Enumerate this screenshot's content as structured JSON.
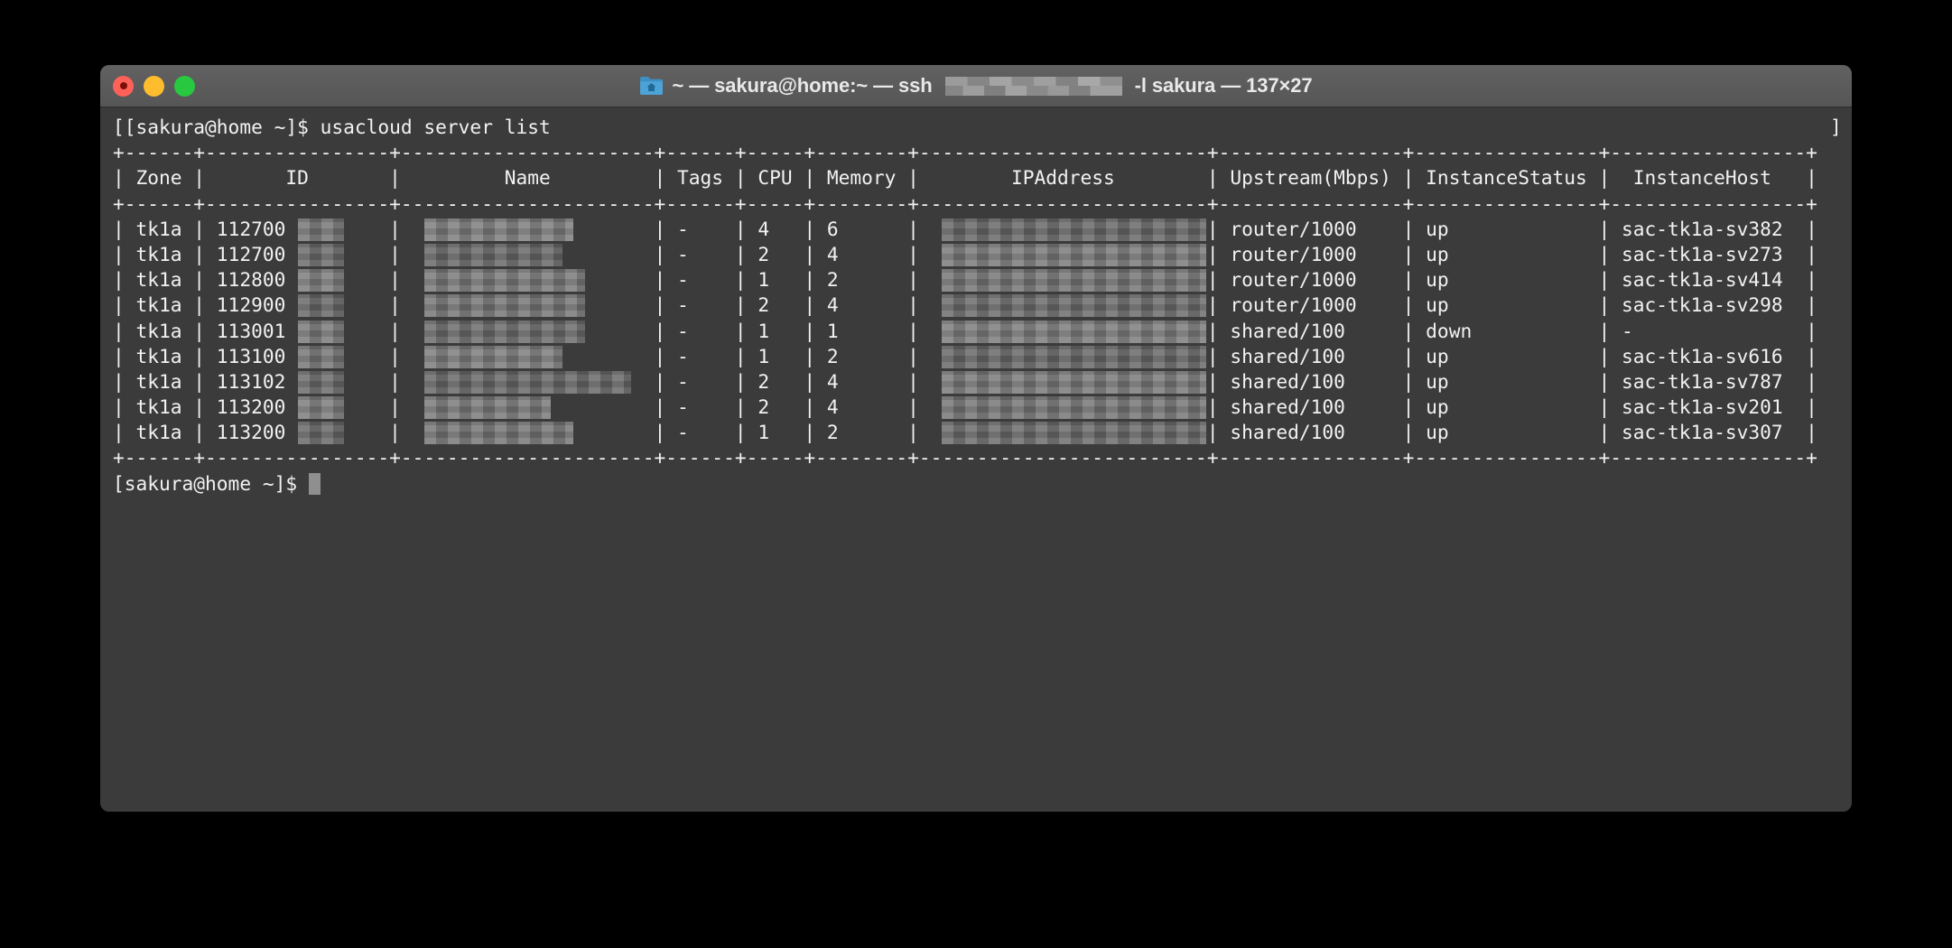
{
  "window": {
    "title_prefix": "~ — sakura@home:~ — ssh ",
    "title_suffix": " -l sakura — 137×27",
    "folder_icon": "home-folder-icon",
    "traffic_lights": [
      {
        "name": "close-button",
        "label": "Close",
        "color": "#ff6159"
      },
      {
        "name": "minimize-button",
        "label": "Minimize",
        "color": "#ffbd2e"
      },
      {
        "name": "maximize-button",
        "label": "Maximize",
        "color": "#28c840"
      }
    ],
    "redacted_host": "[redacted]",
    "columns": "137",
    "rows": "27",
    "titlebar_color": "#5a5a5a",
    "body_color": "#3b3b3b",
    "text_color": "#f2f2f2"
  },
  "terminal": {
    "left_edge_artifact": "[",
    "right_edge_artifact": "]",
    "prompt": "[sakura@home ~]$ ",
    "command": "usacloud server list",
    "final_prompt": "[sakura@home ~]$ ",
    "cursor": "block-cursor"
  },
  "table": {
    "headers": [
      "Zone",
      "ID",
      "Name",
      "Tags",
      "CPU",
      "Memory",
      "IPAddress",
      "Upstream(Mbps)",
      "InstanceStatus",
      "InstanceHost"
    ],
    "separator_char": "+",
    "rule_char": "-",
    "pipe_char": "|",
    "rows": [
      {
        "zone": "tk1a",
        "id": "112700",
        "id_redacted": true,
        "name": "",
        "name_redacted": true,
        "tags": "-",
        "cpu": "4",
        "memory": "6",
        "ip": "",
        "ip_redacted": true,
        "upstream": "router/1000",
        "status": "up",
        "host": "sac-tk1a-sv382"
      },
      {
        "zone": "tk1a",
        "id": "112700",
        "id_redacted": true,
        "name": "",
        "name_redacted": true,
        "tags": "-",
        "cpu": "2",
        "memory": "4",
        "ip": "",
        "ip_redacted": true,
        "upstream": "router/1000",
        "status": "up",
        "host": "sac-tk1a-sv273"
      },
      {
        "zone": "tk1a",
        "id": "112800",
        "id_redacted": true,
        "name": "",
        "name_redacted": true,
        "tags": "-",
        "cpu": "1",
        "memory": "2",
        "ip": "",
        "ip_redacted": true,
        "upstream": "router/1000",
        "status": "up",
        "host": "sac-tk1a-sv414"
      },
      {
        "zone": "tk1a",
        "id": "112900",
        "id_redacted": true,
        "name": "",
        "name_redacted": true,
        "tags": "-",
        "cpu": "2",
        "memory": "4",
        "ip": "",
        "ip_redacted": true,
        "upstream": "router/1000",
        "status": "up",
        "host": "sac-tk1a-sv298"
      },
      {
        "zone": "tk1a",
        "id": "113001",
        "id_redacted": true,
        "name": "",
        "name_redacted": true,
        "tags": "-",
        "cpu": "1",
        "memory": "1",
        "ip": "",
        "ip_redacted": true,
        "upstream": "shared/100",
        "status": "down",
        "host": "-"
      },
      {
        "zone": "tk1a",
        "id": "113100",
        "id_redacted": true,
        "name": "",
        "name_redacted": true,
        "tags": "-",
        "cpu": "1",
        "memory": "2",
        "ip": "",
        "ip_redacted": true,
        "upstream": "shared/100",
        "status": "up",
        "host": "sac-tk1a-sv616"
      },
      {
        "zone": "tk1a",
        "id": "113102",
        "id_redacted": true,
        "name": "",
        "name_redacted": true,
        "tags": "-",
        "cpu": "2",
        "memory": "4",
        "ip": "",
        "ip_redacted": true,
        "upstream": "shared/100",
        "status": "up",
        "host": "sac-tk1a-sv787"
      },
      {
        "zone": "tk1a",
        "id": "113200",
        "id_redacted": true,
        "name": "",
        "name_redacted": true,
        "tags": "-",
        "cpu": "2",
        "memory": "4",
        "ip": "",
        "ip_redacted": true,
        "upstream": "shared/100",
        "status": "up",
        "host": "sac-tk1a-sv201"
      },
      {
        "zone": "tk1a",
        "id": "113200",
        "id_redacted": true,
        "name": "",
        "name_redacted": true,
        "tags": "-",
        "cpu": "1",
        "memory": "2",
        "ip": "",
        "ip_redacted": true,
        "upstream": "shared/100",
        "status": "up",
        "host": "sac-tk1a-sv307"
      }
    ]
  }
}
